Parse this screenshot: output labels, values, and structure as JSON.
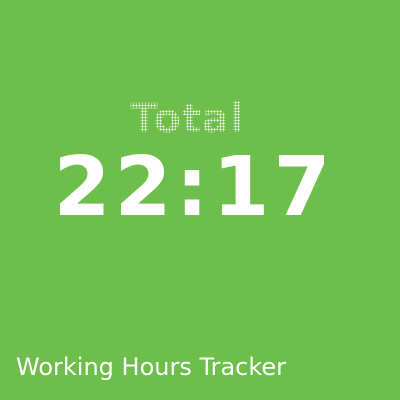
{
  "tile": {
    "background_color": "#6dbe4a",
    "text_color": "#ffffff"
  },
  "summary": {
    "label": "Total",
    "time": "22:17"
  },
  "app": {
    "title": "Working Hours Tracker"
  }
}
